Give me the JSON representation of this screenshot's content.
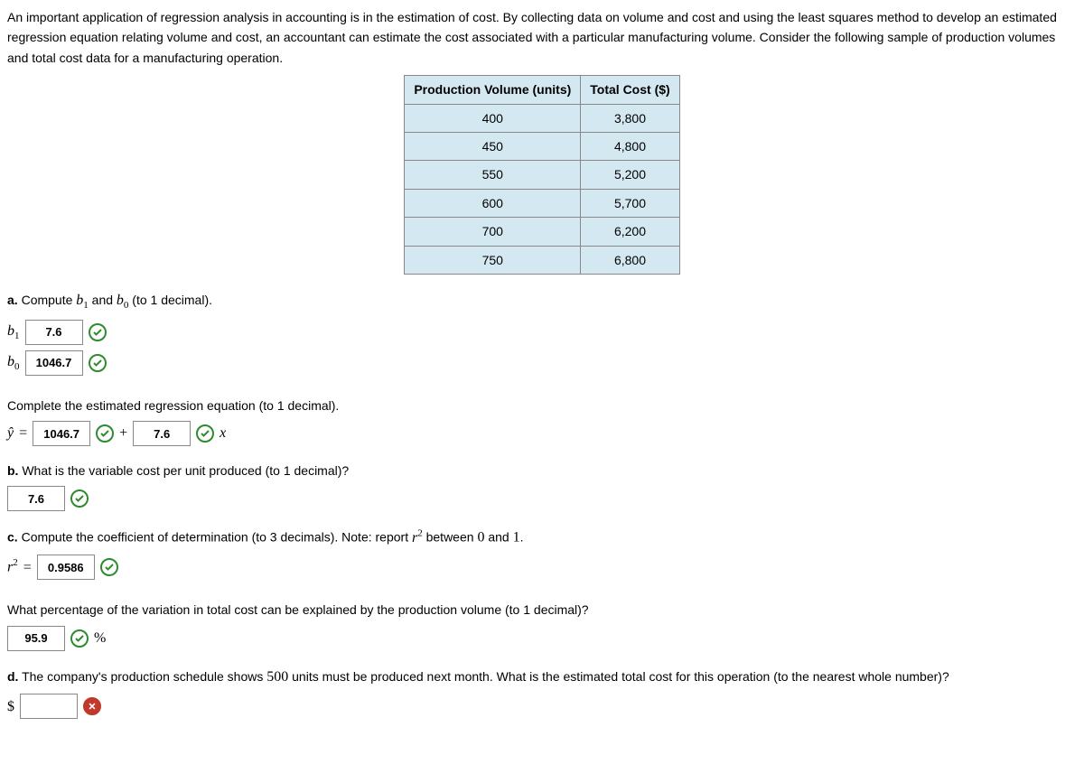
{
  "intro": "An important application of regression analysis in accounting is in the estimation of cost. By collecting data on volume and cost and using the least squares method to develop an estimated regression equation relating volume and cost, an accountant can estimate the cost associated with a particular manufacturing volume. Consider the following sample of production volumes and total cost data for a manufacturing operation.",
  "table": {
    "headers": [
      "Production Volume (units)",
      "Total Cost ($)"
    ],
    "rows": [
      [
        "400",
        "3,800"
      ],
      [
        "450",
        "4,800"
      ],
      [
        "550",
        "5,200"
      ],
      [
        "600",
        "5,700"
      ],
      [
        "700",
        "6,200"
      ],
      [
        "750",
        "6,800"
      ]
    ]
  },
  "a": {
    "prompt_prefix": "a.",
    "prompt": "Compute ",
    "prompt_mid": " and ",
    "prompt_suffix": " (to 1 decimal).",
    "b1_label": "b",
    "b1_sub": "1",
    "b1_val": "7.6",
    "b0_label": "b",
    "b0_sub": "0",
    "b0_val": "1046.7",
    "complete_text": "Complete the estimated regression equation (to 1 decimal).",
    "yhat": "ŷ",
    "eq": "=",
    "eq_b0_val": "1046.7",
    "plus": "+",
    "eq_b1_val": "7.6",
    "x": "x"
  },
  "b": {
    "prompt_prefix": "b.",
    "prompt": "What is the variable cost per unit produced (to 1 decimal)?",
    "val": "7.6"
  },
  "c": {
    "prompt_prefix": "c.",
    "prompt_a": "Compute the coefficient of determination (to 3 decimals). Note: report ",
    "r2": "r",
    "r2sup": "2",
    "prompt_b": " between ",
    "zero": "0",
    "prompt_c": " and ",
    "one": "1",
    "prompt_d": ".",
    "eq": "=",
    "val": "0.9586",
    "pct_prompt": "What percentage of the variation in total cost can be explained by the production volume (to 1 decimal)?",
    "pct_val": "95.9",
    "pct_sym": "%"
  },
  "d": {
    "prompt_prefix": "d.",
    "prompt_a": "The company's production schedule shows ",
    "num": "500",
    "prompt_b": " units must be produced next month. What is the estimated total cost for this operation (to the nearest whole number)?",
    "dollar": "$",
    "val": ""
  }
}
